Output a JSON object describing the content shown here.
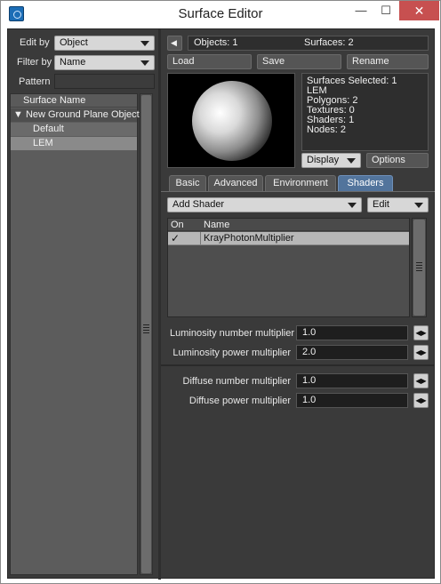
{
  "window": {
    "title": "Surface Editor",
    "minimize": "—",
    "maximize": "☐",
    "close": "✕"
  },
  "left": {
    "edit_by_label": "Edit by",
    "edit_by_value": "Object",
    "filter_by_label": "Filter by",
    "filter_by_value": "Name",
    "pattern_label": "Pattern",
    "list_header": "Surface Name",
    "object_name": "▼ New Ground Plane Object",
    "surfaces": [
      "Default",
      "LEM"
    ]
  },
  "top": {
    "back_arrow": "◀",
    "objects": "Objects: 1",
    "surfaces": "Surfaces: 2",
    "load": "Load",
    "save": "Save",
    "rename": "Rename"
  },
  "info": {
    "lines": [
      "Surfaces Selected: 1",
      "LEM",
      "Polygons: 2",
      "Textures: 0",
      "Shaders: 1",
      "Nodes: 2"
    ],
    "display": "Display",
    "options": "Options"
  },
  "tabs": [
    "Basic",
    "Advanced",
    "Environment",
    "Shaders"
  ],
  "shaders": {
    "add_shader": "Add Shader",
    "edit": "Edit",
    "col_on": "On",
    "col_name": "Name",
    "rows": [
      {
        "on": "✓",
        "name": "KrayPhotonMultiplier"
      }
    ]
  },
  "params": [
    {
      "label": "Luminosity number multiplier",
      "value": "1.0"
    },
    {
      "label": "Luminosity power multiplier",
      "value": "2.0"
    },
    {
      "label": "Diffuse number multiplier",
      "value": "1.0"
    },
    {
      "label": "Diffuse power multiplier",
      "value": "1.0"
    }
  ],
  "stepper_glyph": "◀▶"
}
